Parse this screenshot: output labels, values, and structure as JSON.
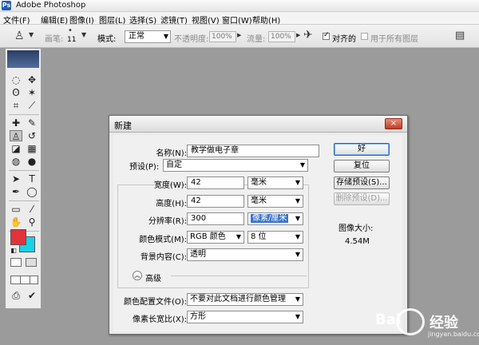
{
  "window": {
    "title": "Adobe Photoshop",
    "icon": "ps-icon"
  },
  "menubar": [
    "文件(F)",
    "编辑(E)",
    "图像(I)",
    "图层(L)",
    "选择(S)",
    "滤镜(T)",
    "视图(V)",
    "窗口(W)",
    "帮助(H)"
  ],
  "options": {
    "brush_label": "画笔:",
    "brush_size": "11",
    "mode_label": "模式:",
    "mode_value": "正常",
    "opacity_label": "不透明度:",
    "opacity_value": "100%",
    "flow_label": "流量:",
    "flow_value": "100%",
    "aligned_label": "对齐的",
    "aligned_checked": true,
    "all_layers_label": "用于所有图层",
    "all_layers_checked": false
  },
  "dialog": {
    "title": "新建",
    "close": "×",
    "name_label": "名称(N):",
    "name_value": "教学做电子章",
    "preset_label": "预设(P):",
    "preset_value": "自定",
    "width_label": "宽度(W):",
    "width_value": "42",
    "width_unit": "毫米",
    "height_label": "高度(H):",
    "height_value": "42",
    "height_unit": "毫米",
    "resolution_label": "分辨率(R):",
    "resolution_value": "300",
    "resolution_unit": "像素/厘米",
    "color_mode_label": "颜色模式(M):",
    "color_mode_value": "RGB 颜色",
    "bit_depth": "8 位",
    "bg_label": "背景内容(C):",
    "bg_value": "透明",
    "advanced_label": "高级",
    "profile_label": "颜色配置文件(O):",
    "profile_value": "不要对此文档进行颜色管理",
    "aspect_label": "像素长宽比(X):",
    "aspect_value": "方形",
    "buttons": {
      "ok": "好",
      "reset": "复位",
      "save_preset": "存储预设(S)...",
      "delete_preset": "删除预设(D)..."
    },
    "image_size_label": "图像大小:",
    "image_size_value": "4.54M"
  },
  "watermark": {
    "brand": "Bai",
    "brand2": "经验",
    "sub": "jingyan.baidu.com"
  },
  "colors": {
    "foreground": "#e2323a",
    "background": "#18d2e7",
    "dialog_bg": "#f0f0f0",
    "canvas_bg": "#9b9b9b"
  }
}
